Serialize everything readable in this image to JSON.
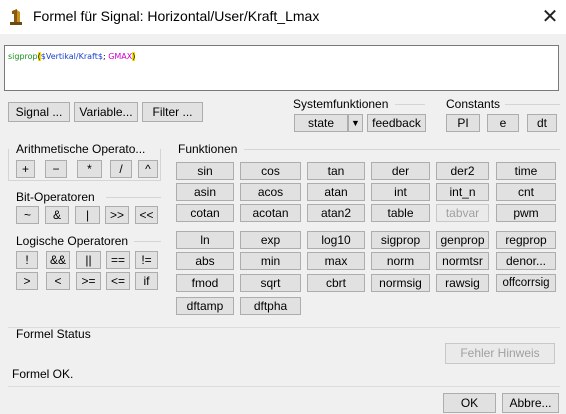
{
  "window": {
    "title": "Formel für Signal: Horizontal/User/Kraft_Lmax",
    "close_glyph": "✕",
    "app_icon": "app-icon"
  },
  "formula": {
    "prefix": "sigprop",
    "open_paren": "(",
    "var": "$Vertikal/Kraft$",
    "sep": "; ",
    "const": "GMAX",
    "close_paren": ")",
    "colors": {
      "func": "#1a8f1a",
      "paren": "#000000",
      "var": "#1a3fcf",
      "const": "#d000d0"
    }
  },
  "toolbar": {
    "signal_label": "Signal ...",
    "variable_label": "Variable...",
    "filter_label": "Filter ..."
  },
  "systemfunktionen": {
    "label": "Systemfunktionen",
    "select_value": "state",
    "dropdown_glyph": "▼",
    "feedback_label": "feedback"
  },
  "constants": {
    "label": "Constants",
    "items": [
      "PI",
      "e",
      "dt"
    ]
  },
  "arith": {
    "label": "Arithmetische Operato...",
    "items": [
      "+",
      "−",
      "*",
      "/",
      "^"
    ]
  },
  "bit": {
    "label": "Bit-Operatoren",
    "items": [
      "~",
      "&",
      "|",
      ">>",
      "<<"
    ]
  },
  "logic": {
    "label": "Logische Operatoren",
    "row1": [
      "!",
      "&&",
      "||",
      "==",
      "!="
    ],
    "row2": [
      ">",
      "<",
      ">=",
      "<=",
      "if"
    ]
  },
  "funktionen": {
    "label": "Funktionen",
    "rows": [
      [
        "sin",
        "cos",
        "tan",
        "der",
        "der2",
        "time"
      ],
      [
        "asin",
        "acos",
        "atan",
        "int",
        "int_n",
        "cnt"
      ],
      [
        "cotan",
        "acotan",
        "atan2",
        "table",
        "tabvar",
        "pwm"
      ],
      [
        "ln",
        "exp",
        "log10",
        "sigprop",
        "genprop",
        "regprop"
      ],
      [
        "abs",
        "min",
        "max",
        "norm",
        "normtsr",
        "denor..."
      ],
      [
        "fmod",
        "sqrt",
        "cbrt",
        "normsig",
        "rawsig",
        "offcorrsig"
      ],
      [
        "dftamp",
        "dftpha"
      ]
    ]
  },
  "status": {
    "label": "Formel Status",
    "hint_label": "Fehler Hinweis",
    "message": "Formel OK."
  },
  "footer": {
    "ok_label": "OK",
    "cancel_label": "Abbre..."
  }
}
